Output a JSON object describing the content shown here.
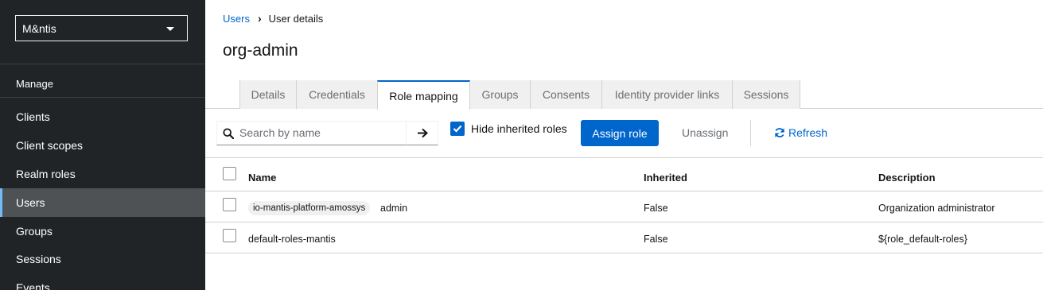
{
  "sidebar": {
    "realm": "M&ntis",
    "section": "Manage",
    "items": [
      {
        "label": "Clients"
      },
      {
        "label": "Client scopes"
      },
      {
        "label": "Realm roles"
      },
      {
        "label": "Users"
      },
      {
        "label": "Groups"
      },
      {
        "label": "Sessions"
      },
      {
        "label": "Events"
      }
    ]
  },
  "breadcrumb": {
    "parent": "Users",
    "current": "User details"
  },
  "page": {
    "title": "org-admin"
  },
  "tabs": [
    {
      "label": "Details"
    },
    {
      "label": "Credentials"
    },
    {
      "label": "Role mapping"
    },
    {
      "label": "Groups"
    },
    {
      "label": "Consents"
    },
    {
      "label": "Identity provider links"
    },
    {
      "label": "Sessions"
    }
  ],
  "toolbar": {
    "search_placeholder": "Search by name",
    "hide_inherited_label": "Hide inherited roles",
    "hide_inherited_checked": true,
    "assign_label": "Assign role",
    "unassign_label": "Unassign",
    "refresh_label": "Refresh"
  },
  "table": {
    "columns": [
      "Name",
      "Inherited",
      "Description"
    ],
    "rows": [
      {
        "client": "io-mantis-platform-amossys",
        "name": "admin",
        "inherited": "False",
        "description": "Organization administrator"
      },
      {
        "client": "",
        "name": "default-roles-mantis",
        "inherited": "False",
        "description": "${role_default-roles}"
      }
    ]
  },
  "colors": {
    "primary": "#0066cc",
    "sidebar_bg": "#212427",
    "active_nav_bg": "#4f5255",
    "active_indicator": "#73bcf7"
  }
}
